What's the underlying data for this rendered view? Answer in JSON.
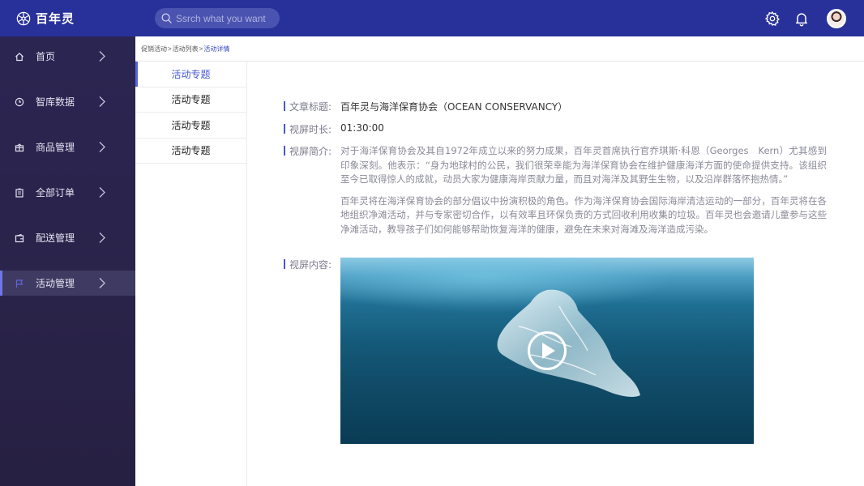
{
  "app": {
    "brand_name": "百年灵"
  },
  "search": {
    "placeholder": "Ssrch what you want"
  },
  "icons": {
    "logo": "snowflake-logo-icon",
    "search": "search-icon",
    "settings": "gear-icon",
    "notifications": "bell-icon",
    "avatar": "user-avatar"
  },
  "sidebar": {
    "items": [
      {
        "label": "首页",
        "icon": "home-icon",
        "active": false
      },
      {
        "label": "智库数据",
        "icon": "clock-icon",
        "active": false
      },
      {
        "label": "商品管理",
        "icon": "gift-icon",
        "active": false
      },
      {
        "label": "全部订单",
        "icon": "clipboard-icon",
        "active": false
      },
      {
        "label": "配送管理",
        "icon": "wallet-icon",
        "active": false
      },
      {
        "label": "活动管理",
        "icon": "flag-icon",
        "active": true
      }
    ]
  },
  "breadcrumb": {
    "items": [
      "促销活动",
      "活动列表",
      "活动详情"
    ],
    "separator": ">"
  },
  "sublist": {
    "items": [
      "活动专题",
      "活动专题",
      "活动专题",
      "活动专题"
    ],
    "active_index": 0
  },
  "detail": {
    "title_label": "文章标题:",
    "title_value": "百年灵与海洋保育协会（OCEAN CONSERVANCY）",
    "duration_label": "视屏时长:",
    "duration_value": "01:30:00",
    "intro_label": "视屏简介:",
    "intro_p1": "对于海洋保育协会及其自1972年成立以来的努力成果，百年灵首席执行官乔琪斯·科恩（Georges　Kern）尤其感到印象深刻。他表示：“身为地球村的公民，我们很荣幸能为海洋保育协会在维护健康海洋方面的使命提供支持。该组织至今已取得惊人的成就，动员大家为健康海岸贡献力量，而且对海洋及其野生生物，以及沿岸群落怀抱热情。”",
    "intro_p2": "百年灵将在海洋保育协会的部分倡议中扮演积极的角色。作为海洋保育协会国际海岸清洁运动的一部分，百年灵将在各地组织净滩活动，并与专家密切合作，以有效率且环保负责的方式回收利用收集的垃圾。百年灵也会邀请儿童参与这些净滩活动，教导孩子们如何能够帮助恢复海洋的健康，避免在未来对海滩及海洋造成污染。",
    "content_label": "视屏内容:",
    "video_icon": "play-icon"
  },
  "colors": {
    "topbar": "#28319a",
    "sidebar": "#2a2349",
    "accent": "#4a57c8",
    "active_text": "#4657d6"
  }
}
